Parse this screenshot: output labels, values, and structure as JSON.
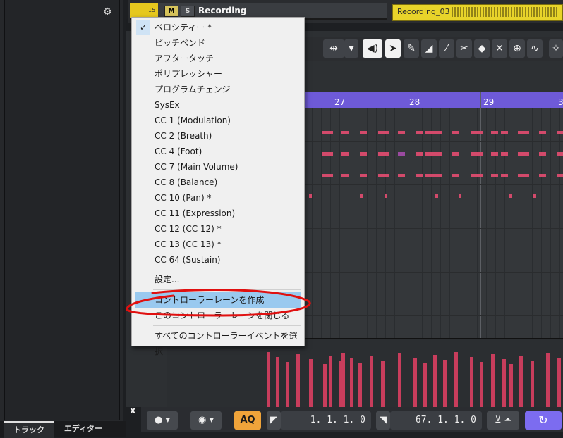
{
  "inspector": {
    "settings_label": "設定"
  },
  "bottom_tabs": {
    "track": "トラック",
    "editor": "エディター"
  },
  "track": {
    "number": "15",
    "mute": "M",
    "solo": "S",
    "name": "Recording"
  },
  "clip": {
    "name": "Recording_03"
  },
  "ruler": {
    "bars": [
      "27",
      "28",
      "29",
      "3"
    ]
  },
  "transport": {
    "aq": "AQ",
    "pos_start": "1.  1.  1.    0",
    "pos_end": "67.  1.  1.    0",
    "close": "x"
  },
  "menu": {
    "items": [
      {
        "label": "ベロシティー *",
        "checked": true
      },
      {
        "label": "ピッチベンド"
      },
      {
        "label": "アフタータッチ"
      },
      {
        "label": "ポリプレッシャー"
      },
      {
        "label": "プログラムチェンジ"
      },
      {
        "label": "SysEx"
      },
      {
        "label": "CC 1  (Modulation)"
      },
      {
        "label": "CC 2  (Breath)"
      },
      {
        "label": "CC 4  (Foot)"
      },
      {
        "label": "CC 7  (Main Volume)"
      },
      {
        "label": "CC 8  (Balance)"
      },
      {
        "label": "CC 10  (Pan) *"
      },
      {
        "label": "CC 11  (Expression)"
      },
      {
        "label": "CC 12  (CC 12) *"
      },
      {
        "label": "CC 13  (CC 13) *"
      },
      {
        "label": "CC 64  (Sustain)"
      }
    ],
    "settings": "設定...",
    "create_lane": "コントローラーレーンを作成",
    "close_lane": "このコントローラーレーンを閉じる",
    "select_all": "すべてのコントローラーイベントを選択"
  },
  "colors": {
    "accent": "#99c9ef",
    "ruler": "#6e5ad8",
    "notes": "#d34a6b",
    "track": "#e6c81e",
    "annotation": "#e01010"
  }
}
